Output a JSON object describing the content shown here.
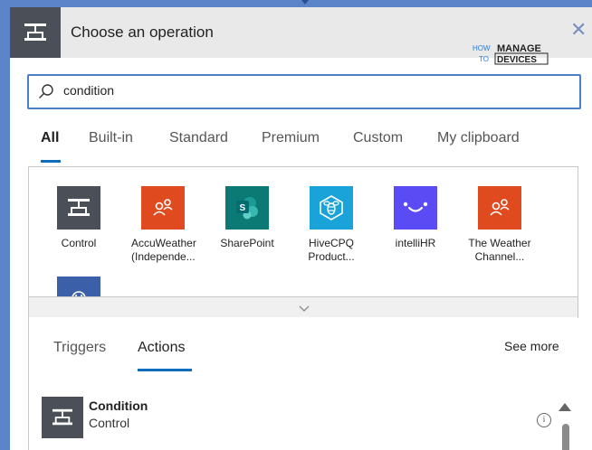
{
  "header": {
    "title": "Choose an operation",
    "icon": "control-icon",
    "close_icon": "close-icon",
    "logo": {
      "line1": "HOW",
      "line2": "TO",
      "word1": "MANAGE",
      "word2": "DEVICES"
    }
  },
  "search": {
    "value": "condition",
    "placeholder": "",
    "icon": "search-icon"
  },
  "tabs": [
    {
      "label": "All",
      "active": true
    },
    {
      "label": "Built-in",
      "active": false
    },
    {
      "label": "Standard",
      "active": false
    },
    {
      "label": "Premium",
      "active": false
    },
    {
      "label": "Custom",
      "active": false
    },
    {
      "label": "My clipboard",
      "active": false
    }
  ],
  "connectors": [
    {
      "label": "Control",
      "label2": "",
      "icon": "control-icon",
      "color": "#4b4f58"
    },
    {
      "label": "AccuWeather",
      "label2": "(Independe...",
      "icon": "weather-people-icon",
      "color": "#e04a1f"
    },
    {
      "label": "SharePoint",
      "label2": "",
      "icon": "sharepoint-icon",
      "color": "#0b7a75"
    },
    {
      "label": "HiveCPQ",
      "label2": "Product...",
      "icon": "hive-icon",
      "color": "#1aa3d9"
    },
    {
      "label": "intelliHR",
      "label2": "",
      "icon": "smile-icon",
      "color": "#5b4bf5"
    },
    {
      "label": "The Weather",
      "label2": "Channel...",
      "icon": "weather-people-icon",
      "color": "#e04a1f"
    },
    {
      "label": "",
      "label2": "",
      "icon": "partial-connector-icon",
      "color": "#3b5fa8"
    }
  ],
  "expander_icon": "chevron-down-icon",
  "lower_tabs": [
    {
      "label": "Triggers",
      "active": false
    },
    {
      "label": "Actions",
      "active": true
    }
  ],
  "see_more": "See more",
  "results": [
    {
      "title": "Condition",
      "subtitle": "Control",
      "icon": "control-icon",
      "info_icon": "info-icon"
    }
  ],
  "colors": {
    "accent": "#0f6cbd",
    "border_frame": "#5b84c9",
    "header_bg": "#e9e9e9",
    "control_dark": "#4b4f58"
  }
}
